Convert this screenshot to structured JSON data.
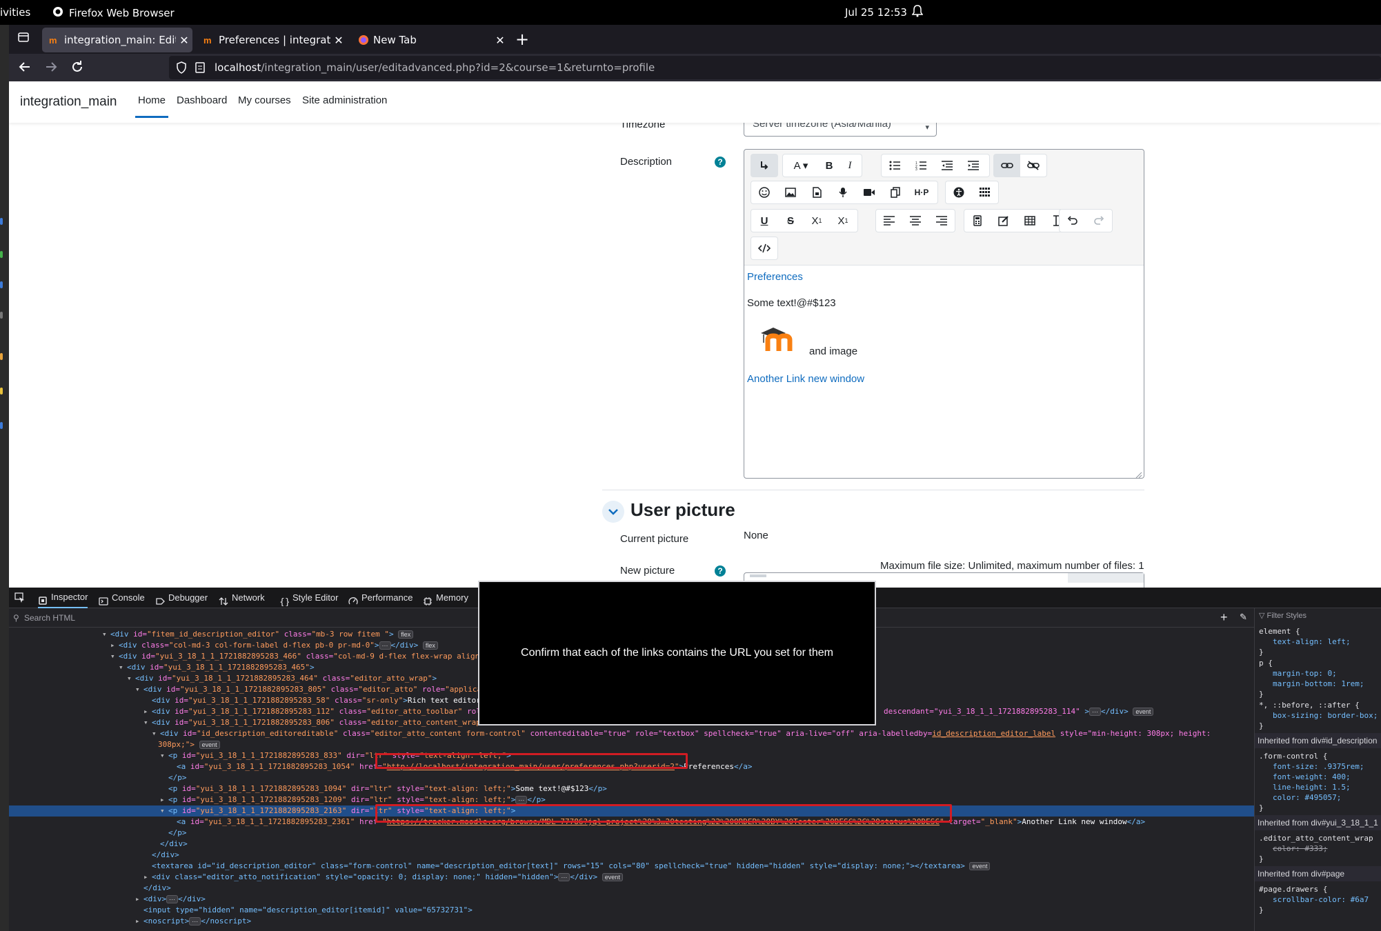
{
  "topbar": {
    "activities": "ivities",
    "app_name": "Firefox Web Browser",
    "clock": "Jul 25  12:53"
  },
  "browser": {
    "tabs": [
      {
        "label": "integration_main: Edit pr",
        "active": true
      },
      {
        "label": "Preferences | integration",
        "active": false
      },
      {
        "label": "New Tab",
        "active": false
      }
    ],
    "url_host": "localhost",
    "url_path": "/integration_main/user/editadvanced.php?id=2&course=1&returnto=profile"
  },
  "moodle": {
    "site_name": "integration_main",
    "nav": [
      "Home",
      "Dashboard",
      "My courses",
      "Site administration"
    ],
    "timezone_label": "Timezone",
    "timezone_value": "Server timezone (Asia/Manila)",
    "description_label": "Description",
    "editor": {
      "link1": "Preferences",
      "text1": "Some text!@#$123",
      "image_caption": "and image",
      "link2": "Another Link new window"
    },
    "user_picture_heading": "User picture",
    "current_picture_label": "Current picture",
    "current_picture_value": "None",
    "new_picture_label": "New picture",
    "max_file_info": "Maximum file size: Unlimited, maximum number of files: 1"
  },
  "devtools": {
    "tabs": [
      "Inspector",
      "Console",
      "Debugger",
      "Network",
      "Style Editor",
      "Performance",
      "Memory"
    ],
    "search_placeholder": "Search HTML",
    "filter_placeholder": "Filter Styles",
    "markup": {
      "l1_id": "fitem_id_description_editor",
      "l1_class": "mb-3 row fitem ",
      "l2_class": "col-md-3 col-form-label d-flex pb-0 pr-md-0",
      "l3_id": "yui_3_18_1_1_1721882895283_466",
      "l3_class": "col-md-9 d-flex flex-wrap align",
      "l4_id": "yui_3_18_1_1_1721882895283_465",
      "l5_id": "yui_3_18_1_1_1721882895283_464",
      "l5_class": "editor_atto_wrap",
      "l6_id": "yui_3_18_1_1_1721882895283_805",
      "l6_class": "editor_atto",
      "l6_role": "applica",
      "l7_id": "yui_3_18_1_1_1721882895283_58",
      "l7_class": "sr-only",
      "l7_text": "Rich text editor",
      "l8_id": "yui_3_18_1_1_1721882895283_112",
      "l8_class": "editor_atto_toolbar",
      "l8_tail": "descendant=\"yui_3_18_1_1_1721882895283_114\"",
      "l9_id": "yui_3_18_1_1_1721882895283_806",
      "l9_class": "editor_atto_content_wrap",
      "l10_id": "id_description_editoreditable",
      "l10_class": "editor_atto_content form-control",
      "l10_rest": "contenteditable=\"true\" role=\"textbox\" spellcheck=\"true\" aria-live=\"off\" aria-labelledby=",
      "l10_label": "id_description_editor_label",
      "l10_style": "style=\"min-height: 308px; height:",
      "l10b": "308px;\">",
      "p1_id": "yui_3_18_1_1_1721882895283_833",
      "a1_id": "yui_3_18_1_1_1721882895283_1054",
      "a1_href": "http://localhost/integration_main/user/preferences.php?userid=2",
      "a1_text": "Preferences",
      "p2_id": "yui_3_18_1_1_1721882895283_1094",
      "p2_text": "Some text!@#$123",
      "p3_id": "yui_3_18_1_1_1721882895283_1209",
      "p4_id": "yui_3_18_1_1_1721882895283_2163",
      "a2_id": "yui_3_18_1_1_1721882895283_2361",
      "a2_href": "https://tracker.moodle.org/browse/MDL-77786?jql=project%20%3…20testing%22%20ORDER%20BY%20Tester%20DESC%2C%20status%20DESC",
      "a2_text": "Another Link new window",
      "ta_line": "<textarea id=\"id_description_editor\" class=\"form-control\" name=\"description_editor[text]\" rows=\"15\" cols=\"80\" spellcheck=\"true\" hidden=\"hidden\" style=\"display: none;\"></textarea>",
      "notif_line": "<div class=\"editor_atto_notification\" style=\"opacity: 0; display: none;\" hidden=\"hidden\">",
      "input_line": "<input type=\"hidden\" name=\"description_editor[itemid]\" value=\"65732731\">"
    },
    "rules": {
      "element_sel": "element",
      "element_decl": "text-align: left;",
      "p_sel": "p",
      "p_decl1": "margin-top: 0;",
      "p_decl2": "margin-bottom: 1rem;",
      "star_sel": "*, ::before, ::after",
      "star_decl": "box-sizing: border-box;",
      "inh1": "Inherited from div#id_description",
      "fc_sel": ".form-control",
      "fc1": "font-size: .9375rem;",
      "fc2": "font-weight: 400;",
      "fc3": "line-height: 1.5;",
      "fc4": "color: #495057;",
      "inh2": "Inherited from div#yui_3_18_1_1",
      "wrap_sel": ".editor_atto_content_wrap",
      "wrap_decl": "color: #333;",
      "inh3": "Inherited from div#page",
      "page_sel": "#page.drawers",
      "page_decl": "scrollbar-color: #6a7"
    }
  },
  "overlay": {
    "message": "Confirm that each of the links contains the URL you set for them"
  }
}
